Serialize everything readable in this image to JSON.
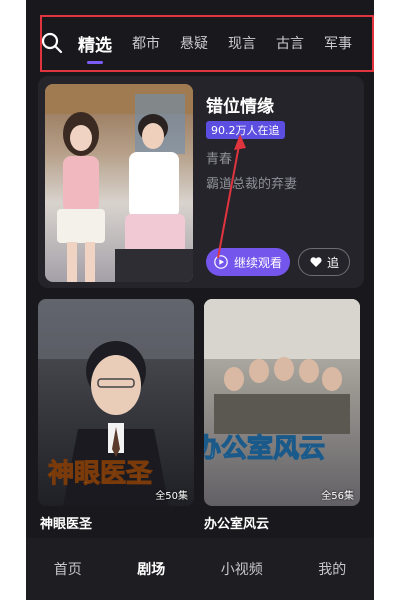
{
  "tabs": {
    "items": [
      "精选",
      "都市",
      "悬疑",
      "现言",
      "古言",
      "军事"
    ],
    "active_index": 0
  },
  "featured": {
    "title": "错位情缘",
    "hot_badge": "90.2万人在追",
    "genre": "青春",
    "description": "霸道总裁的弃妻",
    "continue_label": "继续观看",
    "follow_label": "追"
  },
  "grid": [
    {
      "title": "神眼医圣",
      "episodes": "全50集",
      "poster_text": "神眼医圣"
    },
    {
      "title": "办公室风云",
      "episodes": "全56集",
      "poster_text": "办公室风云"
    }
  ],
  "bottom_nav": {
    "items": [
      "首页",
      "剧场",
      "小视频",
      "我的"
    ],
    "active_index": 1
  },
  "colors": {
    "accent": "#7456ec",
    "badge": "#5b4ee0",
    "annotation": "#e0343e",
    "background": "#19191d"
  }
}
